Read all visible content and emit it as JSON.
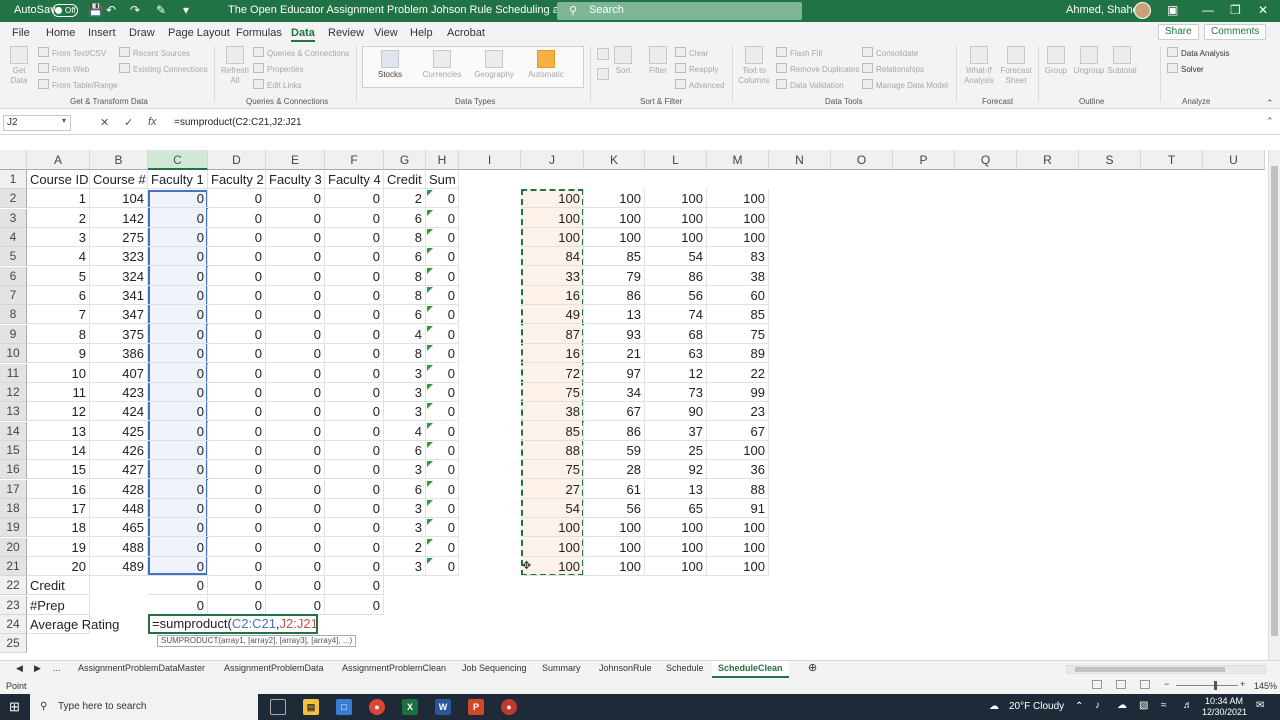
{
  "titlebar": {
    "autosave": "AutoSave",
    "toggle": "Off",
    "doc_title": "The Open Educator Assignment Problem Johson Rule Scheduling and Sequencin...",
    "search_placeholder": "Search",
    "user": "Ahmed, Shaheen"
  },
  "menu": {
    "tabs": [
      "File",
      "Home",
      "Insert",
      "Draw",
      "Page Layout",
      "Formulas",
      "Data",
      "Review",
      "View",
      "Help",
      "Acrobat"
    ],
    "active": "Data",
    "share": "Share",
    "comments": "Comments"
  },
  "ribbon": {
    "get_data": "Get\nData",
    "from_text": "From Text/CSV",
    "from_web": "From Web",
    "from_table": "From Table/Range",
    "recent_sources": "Recent Sources",
    "existing_connections": "Existing Connections",
    "refresh_all": "Refresh\nAll",
    "queries_connections": "Queries & Connections",
    "properties": "Properties",
    "edit_links": "Edit Links",
    "stocks": "Stocks",
    "currencies": "Currencies",
    "geography": "Geography",
    "automatic": "Automatic",
    "sort": "Sort",
    "filter": "Filter",
    "clear": "Clear",
    "reapply": "Reapply",
    "advanced": "Advanced",
    "text_to_columns": "Text to\nColumns",
    "flash_fill": "Flash Fill",
    "remove_duplicates": "Remove Duplicates",
    "data_validation": "Data Validation",
    "consolidate": "Consolidate",
    "relationships": "Relationships",
    "manage_data_model": "Manage Data Model",
    "what_if": "What-If\nAnalysis",
    "forecast_sheet": "Forecast\nSheet",
    "group": "Group",
    "ungroup": "Ungroup",
    "subtotal": "Subtotal",
    "data_analysis": "Data Analysis",
    "solver": "Solver",
    "groups": [
      "Get & Transform Data",
      "Queries & Connections",
      "Data Types",
      "Sort & Filter",
      "Data Tools",
      "Forecast",
      "Outline",
      "Analyze"
    ]
  },
  "formula_bar": {
    "name_box": "J2",
    "formula": "=sumproduct(C2:C21,J2:J21"
  },
  "columns": [
    "A",
    "B",
    "C",
    "D",
    "E",
    "F",
    "G",
    "H",
    "I",
    "J",
    "K",
    "L",
    "M",
    "N",
    "O",
    "P",
    "Q",
    "R",
    "S",
    "T",
    "U"
  ],
  "header_row": [
    "Course ID",
    "Course #",
    "Faculty 1",
    "Faculty 2",
    "Faculty 3",
    "Faculty 4",
    "Credit",
    "Sum"
  ],
  "rows": [
    {
      "id": "1",
      "course": "104",
      "f1": "0",
      "f2": "0",
      "f3": "0",
      "f4": "0",
      "credit": "2",
      "sum": "0",
      "j": "100",
      "k": "100",
      "l": "100",
      "m": "100"
    },
    {
      "id": "2",
      "course": "142",
      "f1": "0",
      "f2": "0",
      "f3": "0",
      "f4": "0",
      "credit": "6",
      "sum": "0",
      "j": "100",
      "k": "100",
      "l": "100",
      "m": "100"
    },
    {
      "id": "3",
      "course": "275",
      "f1": "0",
      "f2": "0",
      "f3": "0",
      "f4": "0",
      "credit": "8",
      "sum": "0",
      "j": "100",
      "k": "100",
      "l": "100",
      "m": "100"
    },
    {
      "id": "4",
      "course": "323",
      "f1": "0",
      "f2": "0",
      "f3": "0",
      "f4": "0",
      "credit": "6",
      "sum": "0",
      "j": "84",
      "k": "85",
      "l": "54",
      "m": "83"
    },
    {
      "id": "5",
      "course": "324",
      "f1": "0",
      "f2": "0",
      "f3": "0",
      "f4": "0",
      "credit": "8",
      "sum": "0",
      "j": "33",
      "k": "79",
      "l": "86",
      "m": "38"
    },
    {
      "id": "6",
      "course": "341",
      "f1": "0",
      "f2": "0",
      "f3": "0",
      "f4": "0",
      "credit": "8",
      "sum": "0",
      "j": "16",
      "k": "86",
      "l": "56",
      "m": "60"
    },
    {
      "id": "7",
      "course": "347",
      "f1": "0",
      "f2": "0",
      "f3": "0",
      "f4": "0",
      "credit": "6",
      "sum": "0",
      "j": "49",
      "k": "13",
      "l": "74",
      "m": "85"
    },
    {
      "id": "8",
      "course": "375",
      "f1": "0",
      "f2": "0",
      "f3": "0",
      "f4": "0",
      "credit": "4",
      "sum": "0",
      "j": "87",
      "k": "93",
      "l": "68",
      "m": "75"
    },
    {
      "id": "9",
      "course": "386",
      "f1": "0",
      "f2": "0",
      "f3": "0",
      "f4": "0",
      "credit": "8",
      "sum": "0",
      "j": "16",
      "k": "21",
      "l": "63",
      "m": "89"
    },
    {
      "id": "10",
      "course": "407",
      "f1": "0",
      "f2": "0",
      "f3": "0",
      "f4": "0",
      "credit": "3",
      "sum": "0",
      "j": "72",
      "k": "97",
      "l": "12",
      "m": "22"
    },
    {
      "id": "11",
      "course": "423",
      "f1": "0",
      "f2": "0",
      "f3": "0",
      "f4": "0",
      "credit": "3",
      "sum": "0",
      "j": "75",
      "k": "34",
      "l": "73",
      "m": "99"
    },
    {
      "id": "12",
      "course": "424",
      "f1": "0",
      "f2": "0",
      "f3": "0",
      "f4": "0",
      "credit": "3",
      "sum": "0",
      "j": "38",
      "k": "67",
      "l": "90",
      "m": "23"
    },
    {
      "id": "13",
      "course": "425",
      "f1": "0",
      "f2": "0",
      "f3": "0",
      "f4": "0",
      "credit": "4",
      "sum": "0",
      "j": "85",
      "k": "86",
      "l": "37",
      "m": "67"
    },
    {
      "id": "14",
      "course": "426",
      "f1": "0",
      "f2": "0",
      "f3": "0",
      "f4": "0",
      "credit": "6",
      "sum": "0",
      "j": "88",
      "k": "59",
      "l": "25",
      "m": "100"
    },
    {
      "id": "15",
      "course": "427",
      "f1": "0",
      "f2": "0",
      "f3": "0",
      "f4": "0",
      "credit": "3",
      "sum": "0",
      "j": "75",
      "k": "28",
      "l": "92",
      "m": "36"
    },
    {
      "id": "16",
      "course": "428",
      "f1": "0",
      "f2": "0",
      "f3": "0",
      "f4": "0",
      "credit": "6",
      "sum": "0",
      "j": "27",
      "k": "61",
      "l": "13",
      "m": "88"
    },
    {
      "id": "17",
      "course": "448",
      "f1": "0",
      "f2": "0",
      "f3": "0",
      "f4": "0",
      "credit": "3",
      "sum": "0",
      "j": "54",
      "k": "56",
      "l": "65",
      "m": "91"
    },
    {
      "id": "18",
      "course": "465",
      "f1": "0",
      "f2": "0",
      "f3": "0",
      "f4": "0",
      "credit": "3",
      "sum": "0",
      "j": "100",
      "k": "100",
      "l": "100",
      "m": "100"
    },
    {
      "id": "19",
      "course": "488",
      "f1": "0",
      "f2": "0",
      "f3": "0",
      "f4": "0",
      "credit": "2",
      "sum": "0",
      "j": "100",
      "k": "100",
      "l": "100",
      "m": "100"
    },
    {
      "id": "20",
      "course": "489",
      "f1": "0",
      "f2": "0",
      "f3": "0",
      "f4": "0",
      "credit": "3",
      "sum": "0",
      "j": "100",
      "k": "100",
      "l": "100",
      "m": "100"
    }
  ],
  "summary_rows": [
    {
      "label": "Credit",
      "values": [
        "0",
        "0",
        "0",
        "0"
      ]
    },
    {
      "label": "#Prep",
      "values": [
        "0",
        "0",
        "0",
        "0"
      ]
    },
    {
      "label": "Average Rating",
      "values": []
    }
  ],
  "edit_cell": {
    "prefix": "=sumproduct(",
    "ref1": "C2:C21",
    "sep": ",",
    "ref2": "J2:J21",
    "tooltip": "SUMPRODUCT(array1, [array2], [array3], [array4], ...)"
  },
  "sheet_tabs": [
    "...",
    "AssignmentProblemDataMaster",
    "AssignmentProblemData",
    "AssignmentProblemClean",
    "Job Sequencing",
    "Summary",
    "JohnsonRule",
    "Schedule",
    "ScheduleClean"
  ],
  "active_sheet": "ScheduleClean",
  "status": {
    "mode": "Point",
    "zoom": "145%"
  },
  "taskbar": {
    "search": "Type here to search",
    "weather": "20°F  Cloudy",
    "time": "10:34 AM",
    "date": "12/30/2021"
  },
  "colors": {
    "excel_green": "#217346",
    "ref1_blue": "#4472c4",
    "ref2_red": "#c0504d"
  }
}
